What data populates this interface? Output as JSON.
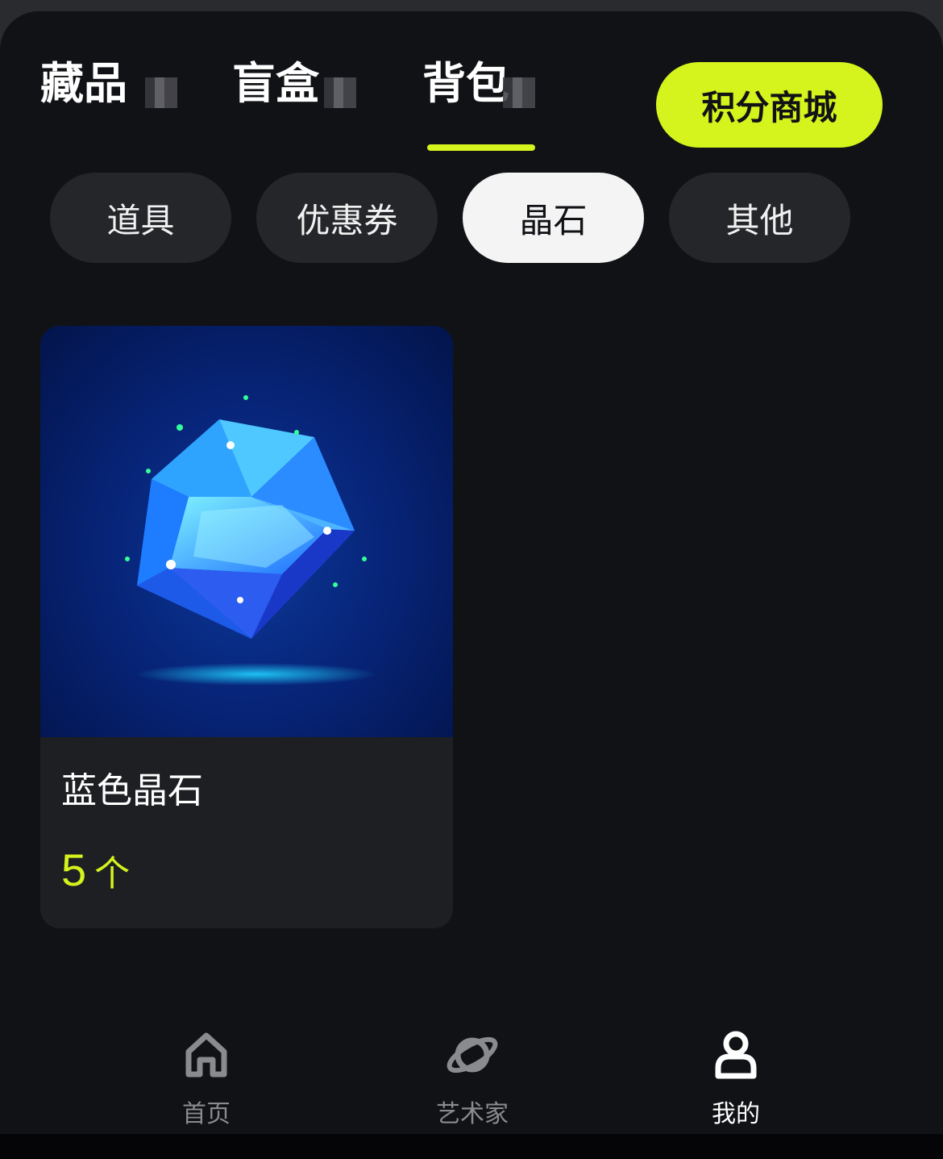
{
  "tabs": [
    {
      "label": "藏品"
    },
    {
      "label": "盲盒"
    },
    {
      "label": "背包",
      "active": true
    }
  ],
  "points_mall": {
    "label": "积分商城"
  },
  "categories": [
    {
      "label": "道具"
    },
    {
      "label": "优惠券"
    },
    {
      "label": "晶石",
      "active": true
    },
    {
      "label": "其他"
    }
  ],
  "items": [
    {
      "name": "蓝色晶石",
      "quantity": "5",
      "unit": "个",
      "image": "blue-crystal"
    }
  ],
  "nav": [
    {
      "label": "首页",
      "icon": "home-icon"
    },
    {
      "label": "艺术家",
      "icon": "planet-icon"
    },
    {
      "label": "我的",
      "icon": "user-icon",
      "active": true
    }
  ],
  "colors": {
    "accent": "#d5f31d",
    "background": "#111216",
    "card": "#1e1f23",
    "pill": "#25262a"
  }
}
